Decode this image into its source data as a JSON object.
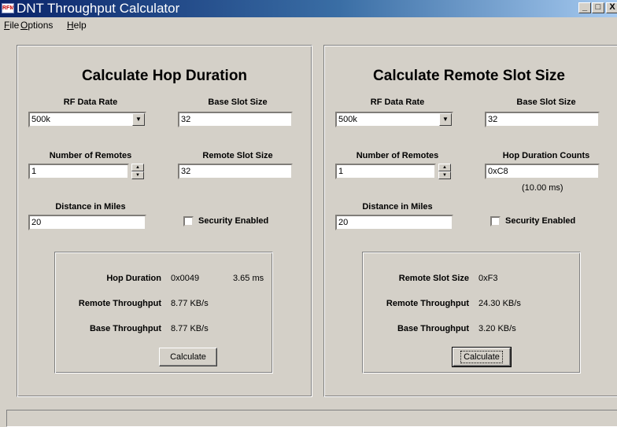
{
  "window": {
    "icon_text": "RFM",
    "title": "DNT Throughput Calculator",
    "min_icon": "_",
    "max_icon": "□",
    "close_icon": "X"
  },
  "menu": {
    "file": "File",
    "options": "Options",
    "help": "Help"
  },
  "left": {
    "title": "Calculate Hop Duration",
    "rf_rate_label": "RF Data Rate",
    "rf_rate_value": "500k",
    "base_slot_label": "Base Slot Size",
    "base_slot_value": "32",
    "remotes_label": "Number of Remotes",
    "remotes_value": "1",
    "remote_slot_label": "Remote Slot Size",
    "remote_slot_value": "32",
    "distance_label": "Distance in Miles",
    "distance_value": "20",
    "security_label": "Security Enabled",
    "security_checked": false,
    "results": {
      "hop_label": "Hop Duration",
      "hop_hex": "0x0049",
      "hop_ms": "3.65 ms",
      "remote_tp_label": "Remote Throughput",
      "remote_tp": "8.77 KB/s",
      "base_tp_label": "Base Throughput",
      "base_tp": "8.77 KB/s"
    },
    "calc_label": "Calculate"
  },
  "right": {
    "title": "Calculate Remote Slot Size",
    "rf_rate_label": "RF Data Rate",
    "rf_rate_value": "500k",
    "base_slot_label": "Base Slot Size",
    "base_slot_value": "32",
    "remotes_label": "Number of Remotes",
    "remotes_value": "1",
    "hop_counts_label": "Hop Duration Counts",
    "hop_counts_value": "0xC8",
    "hop_counts_ms": "(10.00 ms)",
    "distance_label": "Distance in Miles",
    "distance_value": "20",
    "security_label": "Security Enabled",
    "security_checked": false,
    "results": {
      "slot_label": "Remote Slot Size",
      "slot_value": "0xF3",
      "remote_tp_label": "Remote Throughput",
      "remote_tp": "24.30 KB/s",
      "base_tp_label": "Base Throughput",
      "base_tp": "3.20 KB/s"
    },
    "calc_label": "Calculate"
  },
  "icons": {
    "dropdown": "chevron-down-icon",
    "spin_up": "spin-up-icon",
    "spin_down": "spin-down-icon"
  }
}
